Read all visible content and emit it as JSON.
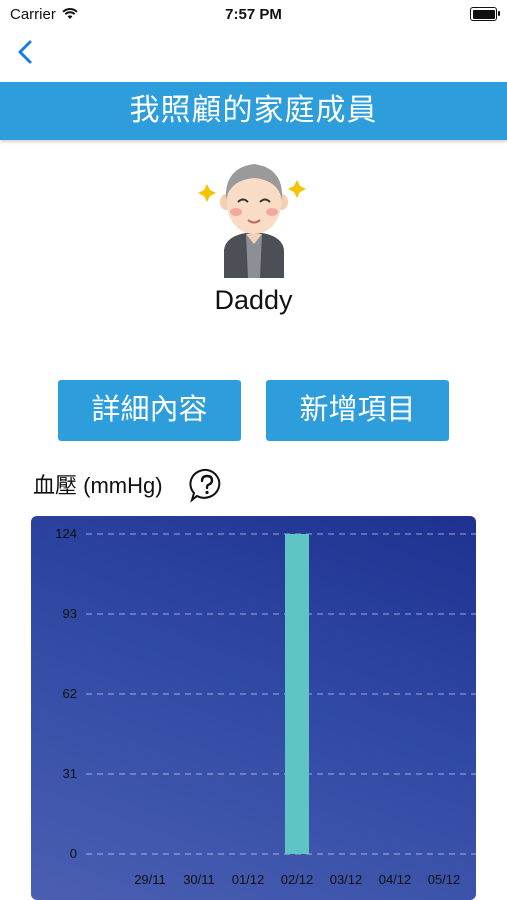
{
  "status_bar": {
    "carrier": "Carrier",
    "time": "7:57 PM"
  },
  "header": {
    "title": "我照顧的家庭成員"
  },
  "profile": {
    "name": "Daddy"
  },
  "actions": {
    "details_label": "詳細內容",
    "add_label": "新增項目"
  },
  "section": {
    "label": "血壓 (mmHg)"
  },
  "colors": {
    "accent": "#2e9ddc",
    "bar": "#5fc4c4",
    "chart_bg": "#2d44a0"
  },
  "chart_data": {
    "type": "bar",
    "categories": [
      "29/11",
      "30/11",
      "01/12",
      "02/12",
      "03/12",
      "04/12",
      "05/12"
    ],
    "values": [
      0,
      0,
      0,
      124,
      0,
      0,
      0
    ],
    "y_ticks": [
      0,
      31,
      62,
      93,
      124
    ],
    "ylim": [
      0,
      124
    ],
    "grid": true,
    "title": "",
    "xlabel": "",
    "ylabel": ""
  }
}
